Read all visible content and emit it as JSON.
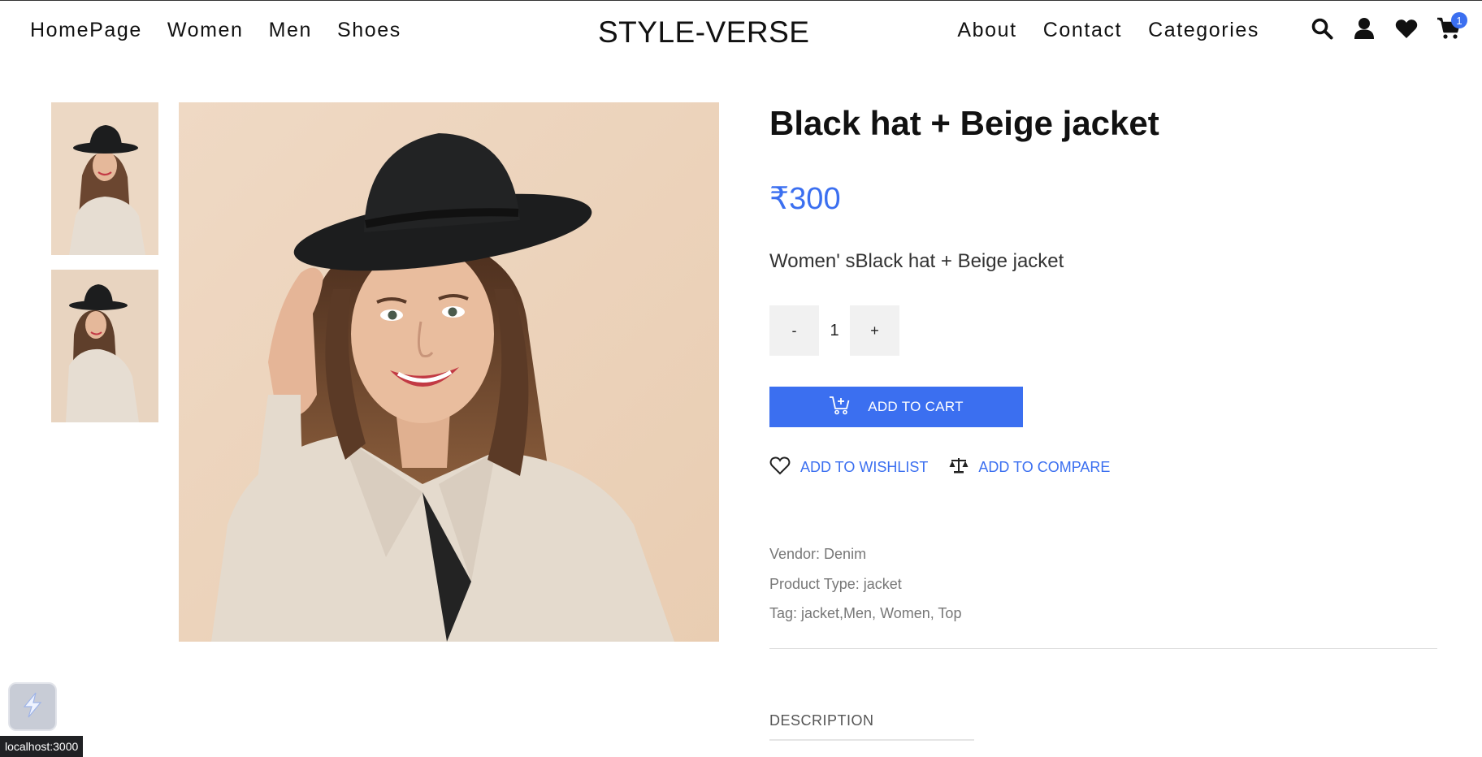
{
  "nav": {
    "left": [
      "HomePage",
      "Women",
      "Men",
      "Shoes"
    ],
    "brand": "STYLE-VERSE",
    "right": [
      "About",
      "Contact",
      "Categories"
    ],
    "icons": [
      "search-icon",
      "user-icon",
      "heart-icon",
      "cart-icon"
    ],
    "cart_count": "1"
  },
  "product": {
    "title": "Black hat + Beige jacket",
    "price": "₹300",
    "description": "Women' sBlack hat + Beige jacket",
    "qty_minus": "-",
    "quantity": "1",
    "qty_plus": "+",
    "add_to_cart": "ADD TO CART",
    "wishlist": "ADD TO WISHLIST",
    "compare": "ADD TO COMPARE",
    "vendor": "Vendor: Denim",
    "type": "Product Type: jacket",
    "tags": "Tag: jacket,Men, Women, Top",
    "tab": "DESCRIPTION"
  },
  "status_bar": "localhost:3000",
  "colors": {
    "accent": "#3b6ff0",
    "photo_bg": "#ecd4bc",
    "coat": "#e4dacd",
    "hat": "#1c1d1e"
  }
}
